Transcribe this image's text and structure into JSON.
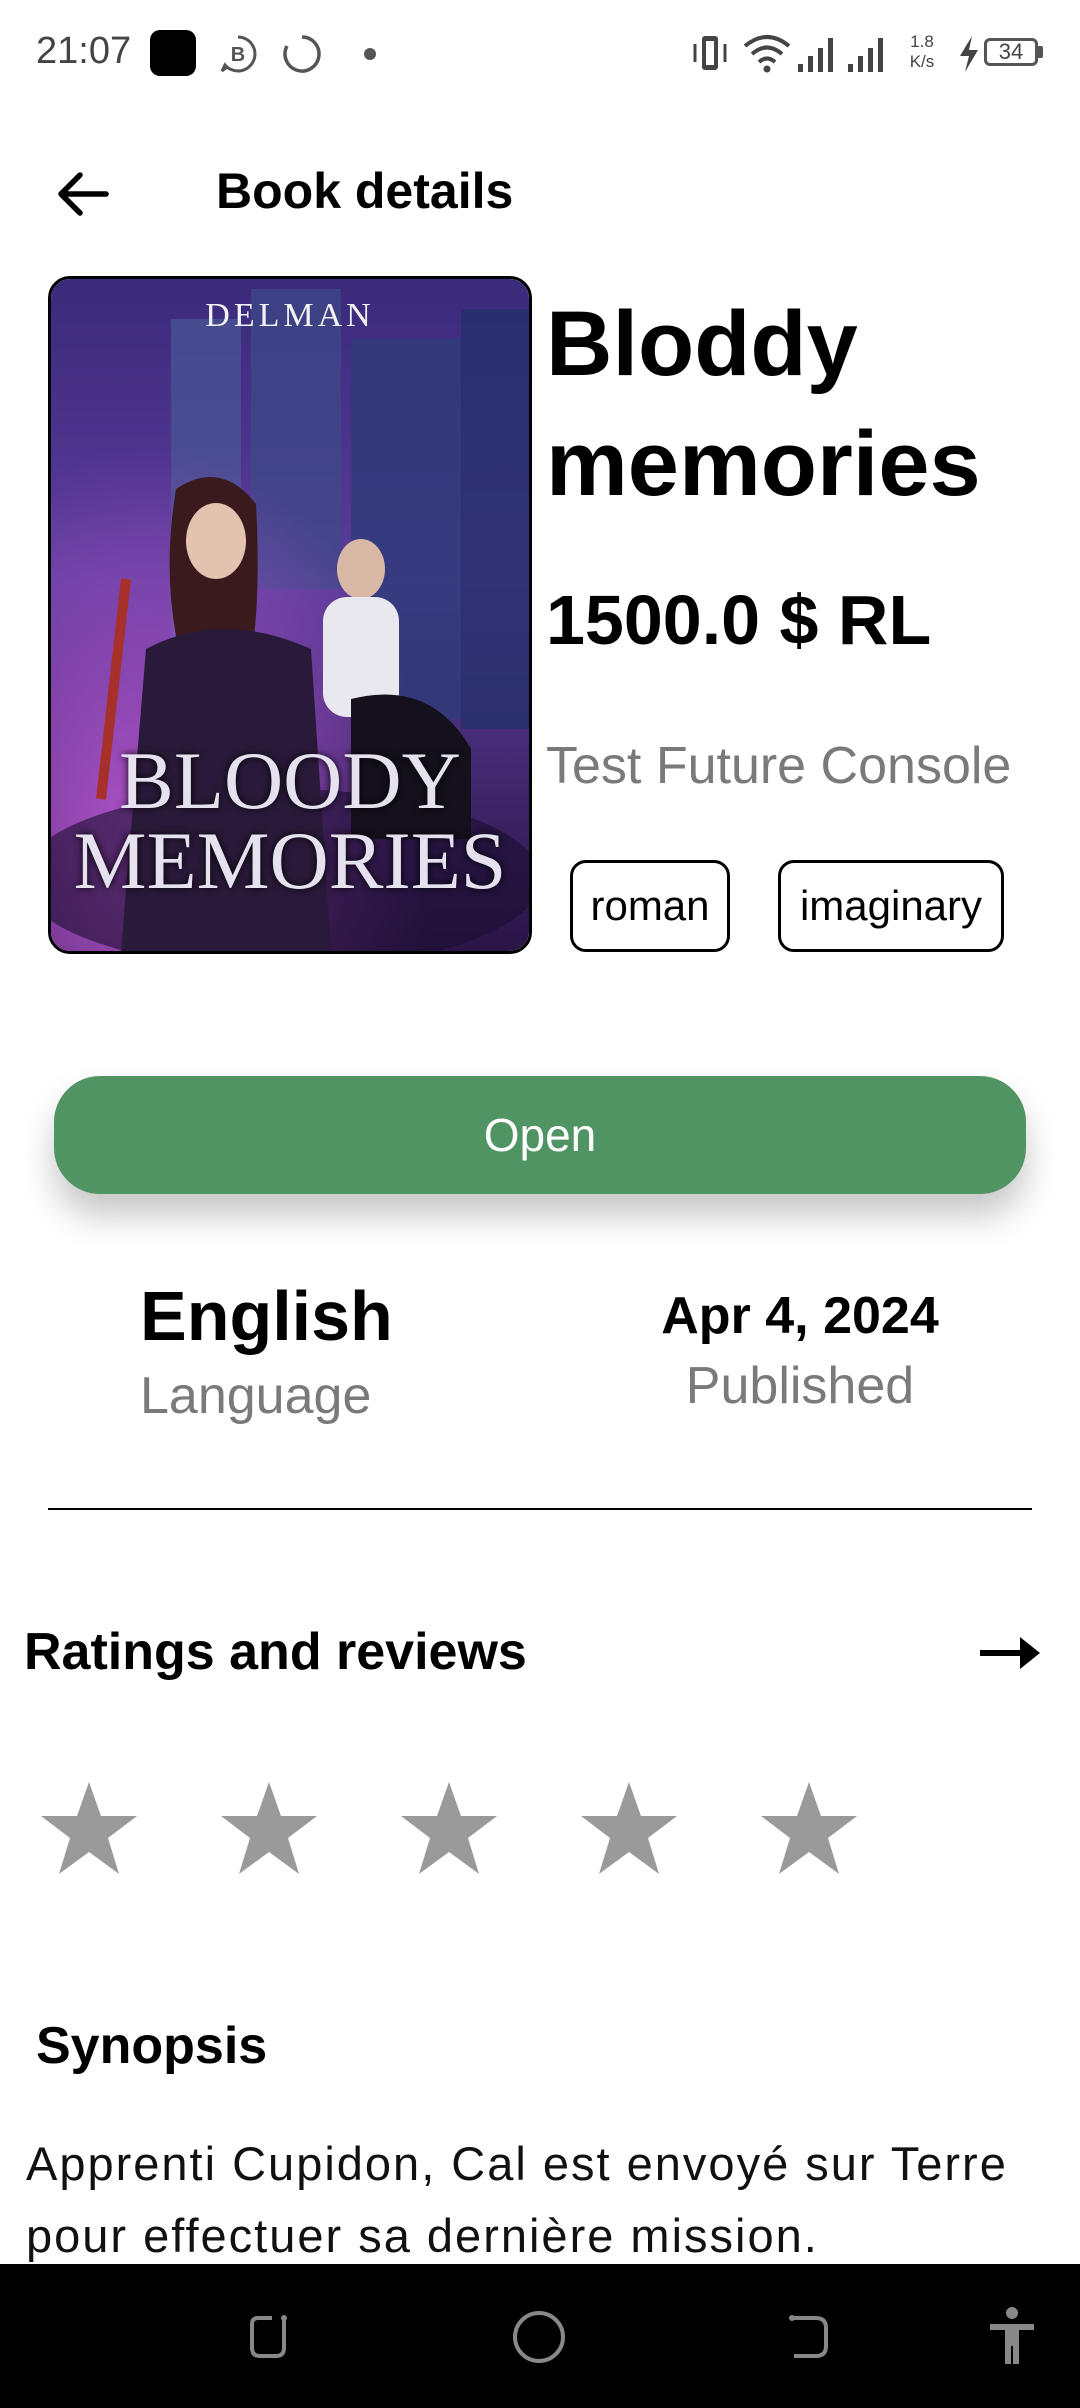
{
  "status_bar": {
    "time": "21:07",
    "b_icon_letter": "B",
    "net_speed_value": "1.8",
    "net_speed_unit": "K/s",
    "battery": "34",
    "icons": [
      "black-app-icon",
      "b-icon",
      "loading-icon",
      "dot-icon",
      "vibrate-icon",
      "wifi-icon",
      "signal-icon",
      "signal-icon",
      "charging-icon",
      "battery-icon"
    ]
  },
  "app_bar": {
    "title": "Book details",
    "back_icon": "arrow-left-icon"
  },
  "book": {
    "cover_author": "DELMAN",
    "cover_title_line1": "BLOODY",
    "cover_title_line2": "MEMORIES",
    "title": "Bloddy memories",
    "price": "1500.0 $ RL",
    "author": "Test Future Console",
    "tags": [
      "roman",
      "imaginary"
    ]
  },
  "actions": {
    "open_label": "Open"
  },
  "info": {
    "language_value": "English",
    "language_label": "Language",
    "published_value": "Apr 4, 2024",
    "published_label": "Published"
  },
  "ratings": {
    "title": "Ratings and reviews",
    "stars_filled": 0,
    "stars_total": 5,
    "star_color": "#9a9a9a"
  },
  "synopsis": {
    "title": "Synopsis",
    "text": "Apprenti Cupidon, Cal est envoyé sur Terre pour effectuer sa dernière mission."
  },
  "nav_bar": {
    "icons": [
      "recent-apps-icon",
      "home-icon",
      "back-icon",
      "accessibility-icon"
    ]
  },
  "colors": {
    "accent_green": "#519463",
    "muted_text": "#7a7a7a"
  }
}
